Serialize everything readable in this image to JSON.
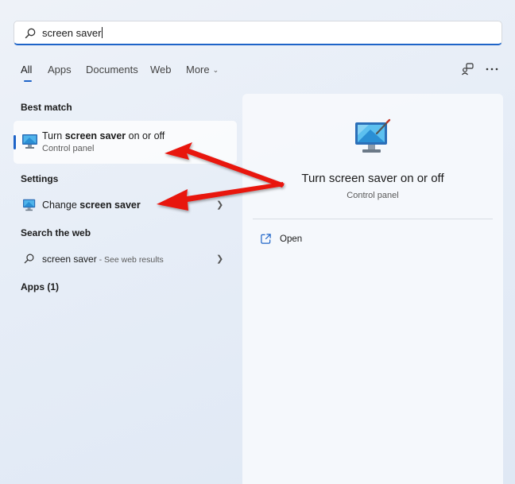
{
  "search": {
    "value": "screen saver"
  },
  "tabs": [
    {
      "label": "All"
    },
    {
      "label": "Apps"
    },
    {
      "label": "Documents"
    },
    {
      "label": "Web"
    },
    {
      "label": "More"
    }
  ],
  "sections": {
    "best_match": "Best match",
    "settings": "Settings",
    "search_web": "Search the web",
    "apps": "Apps (1)"
  },
  "best_match_item": {
    "title_prefix": "Turn ",
    "title_bold": "screen saver",
    "title_suffix": " on or off",
    "subtitle": "Control panel"
  },
  "settings_item": {
    "title_prefix": "Change ",
    "title_bold": "screen saver"
  },
  "web_item": {
    "query": "screen saver",
    "suffix": " - See web results"
  },
  "details": {
    "title": "Turn screen saver on or off",
    "subtitle": "Control panel",
    "action_label": "Open"
  },
  "icons": {
    "search": "search-icon",
    "share": "share-icon",
    "more": "more-options-icon",
    "control_panel": "display-icon",
    "open": "open-external-icon",
    "chevron": "chevron-right-icon"
  },
  "colors": {
    "accent": "#1e64c8",
    "annotation_arrow": "#e8120c"
  }
}
